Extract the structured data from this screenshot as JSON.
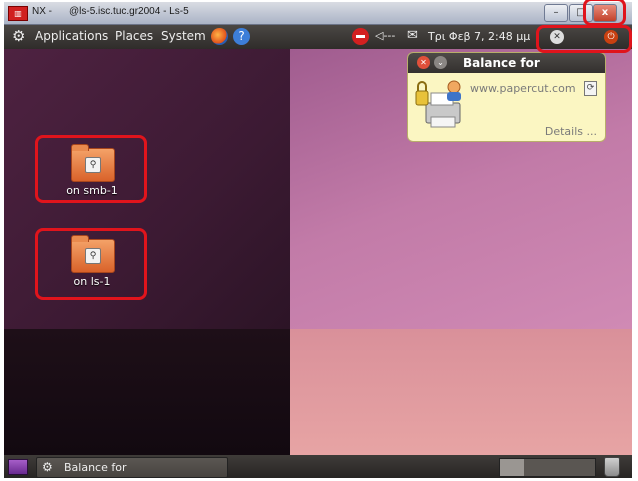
{
  "window": {
    "app_label": "NX -",
    "host": "@ls-5.isc.tuc.gr2004 - Ls-5",
    "close_symbol": "x"
  },
  "top_panel": {
    "menus": [
      "Applications",
      "Places",
      "System"
    ],
    "volume": "◁---",
    "date_time": "Τρι Φεβ  7,  2:48 μμ"
  },
  "desktop_icons": [
    {
      "label": "on smb-1"
    },
    {
      "label": "on ls-1"
    }
  ],
  "notification": {
    "title": "Balance for",
    "site": "www.papercut.com",
    "details": "Details ..."
  },
  "bottom_panel": {
    "task_label": "Balance for"
  },
  "colors": {
    "highlight": "#e0141c",
    "bubble_bg": "#fbf6c2",
    "panel": "#3a3735"
  }
}
